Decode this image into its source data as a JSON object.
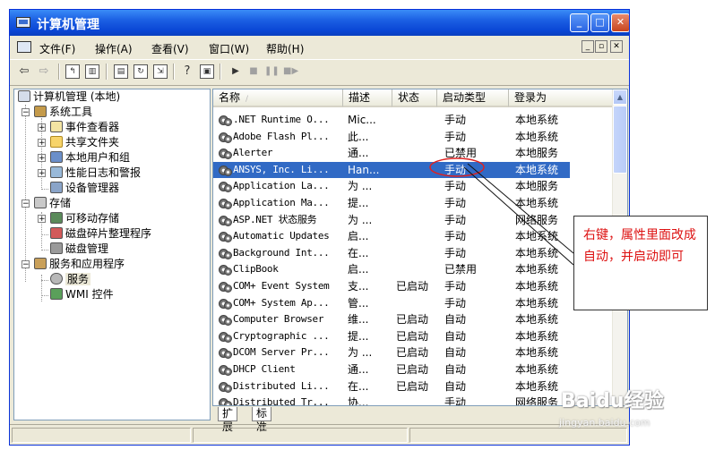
{
  "window": {
    "title": "计算机管理",
    "controls": {
      "minimize": "_",
      "maximize": "□",
      "close": "✕"
    }
  },
  "menu": {
    "items": [
      "文件(F)",
      "操作(A)",
      "查看(V)",
      "窗口(W)",
      "帮助(H)"
    ],
    "mdi_controls": [
      "_",
      "▫",
      "✕"
    ]
  },
  "toolbar": {
    "icons": [
      "back-arrow-icon",
      "forward-arrow-icon",
      "up-folder-icon",
      "show-tree-icon",
      "properties-icon",
      "refresh-icon",
      "export-icon",
      "help-icon",
      "console-icon",
      "play-icon",
      "stop-icon",
      "pause-icon",
      "restart-icon"
    ]
  },
  "tree": {
    "root": "计算机管理 (本地)",
    "system_tools": "系统工具",
    "event_viewer": "事件查看器",
    "shared_folders": "共享文件夹",
    "local_users": "本地用户和组",
    "perf_logs": "性能日志和警报",
    "device_manager": "设备管理器",
    "storage": "存储",
    "removable": "可移动存储",
    "defrag": "磁盘碎片整理程序",
    "disk_mgmt": "磁盘管理",
    "services_apps": "服务和应用程序",
    "services": "服务",
    "wmi": "WMI 控件",
    "expander_plus": "+",
    "expander_minus": "−"
  },
  "list": {
    "columns": [
      "名称",
      "描述",
      "状态",
      "启动类型",
      "登录为"
    ],
    "sort_indicator": "/",
    "rows": [
      {
        "name": ".NET Runtime O...",
        "desc": "Mic...",
        "status": "",
        "startup": "手动",
        "logon": "本地系统"
      },
      {
        "name": "Adobe Flash Pl...",
        "desc": "此...",
        "status": "",
        "startup": "手动",
        "logon": "本地系统"
      },
      {
        "name": "Alerter",
        "desc": "通...",
        "status": "",
        "startup": "已禁用",
        "logon": "本地服务"
      },
      {
        "name": "ANSYS, Inc. Li...",
        "desc": "Han...",
        "status": "",
        "startup": "手动",
        "logon": "本地系统"
      },
      {
        "name": "Application La...",
        "desc": "为 ...",
        "status": "",
        "startup": "手动",
        "logon": "本地服务"
      },
      {
        "name": "Application Ma...",
        "desc": "提...",
        "status": "",
        "startup": "手动",
        "logon": "本地系统"
      },
      {
        "name": "ASP.NET 状态服务",
        "desc": "为 ...",
        "status": "",
        "startup": "手动",
        "logon": "网络服务"
      },
      {
        "name": "Automatic Updates",
        "desc": "启...",
        "status": "",
        "startup": "手动",
        "logon": "本地系统"
      },
      {
        "name": "Background Int...",
        "desc": "在...",
        "status": "",
        "startup": "手动",
        "logon": "本地系统"
      },
      {
        "name": "ClipBook",
        "desc": "启...",
        "status": "",
        "startup": "已禁用",
        "logon": "本地系统"
      },
      {
        "name": "COM+ Event System",
        "desc": "支...",
        "status": "已启动",
        "startup": "手动",
        "logon": "本地系统"
      },
      {
        "name": "COM+ System Ap...",
        "desc": "管...",
        "status": "",
        "startup": "手动",
        "logon": "本地系统"
      },
      {
        "name": "Computer Browser",
        "desc": "维...",
        "status": "已启动",
        "startup": "自动",
        "logon": "本地系统"
      },
      {
        "name": "Cryptographic ...",
        "desc": "提...",
        "status": "已启动",
        "startup": "自动",
        "logon": "本地系统"
      },
      {
        "name": "DCOM Server Pr...",
        "desc": "为 ...",
        "status": "已启动",
        "startup": "自动",
        "logon": "本地系统"
      },
      {
        "name": "DHCP Client",
        "desc": "通...",
        "status": "已启动",
        "startup": "自动",
        "logon": "本地系统"
      },
      {
        "name": "Distributed Li...",
        "desc": "在...",
        "status": "已启动",
        "startup": "自动",
        "logon": "本地系统"
      },
      {
        "name": "Distributed Tr...",
        "desc": "协...",
        "status": "",
        "startup": "手动",
        "logon": "网络服务"
      }
    ],
    "selected_index": 3
  },
  "tabs": [
    "扩展",
    "标准"
  ],
  "annotation": {
    "text": "右键，属性里面改成自动，并启动即可",
    "color": "#dd1111"
  },
  "watermark": {
    "main": "Baidu经验",
    "sub": "jingyan.baidu.com"
  },
  "colors": {
    "title_blue": "#0a46d5",
    "selection": "#316ac5",
    "annotation_red": "#dd1111"
  }
}
